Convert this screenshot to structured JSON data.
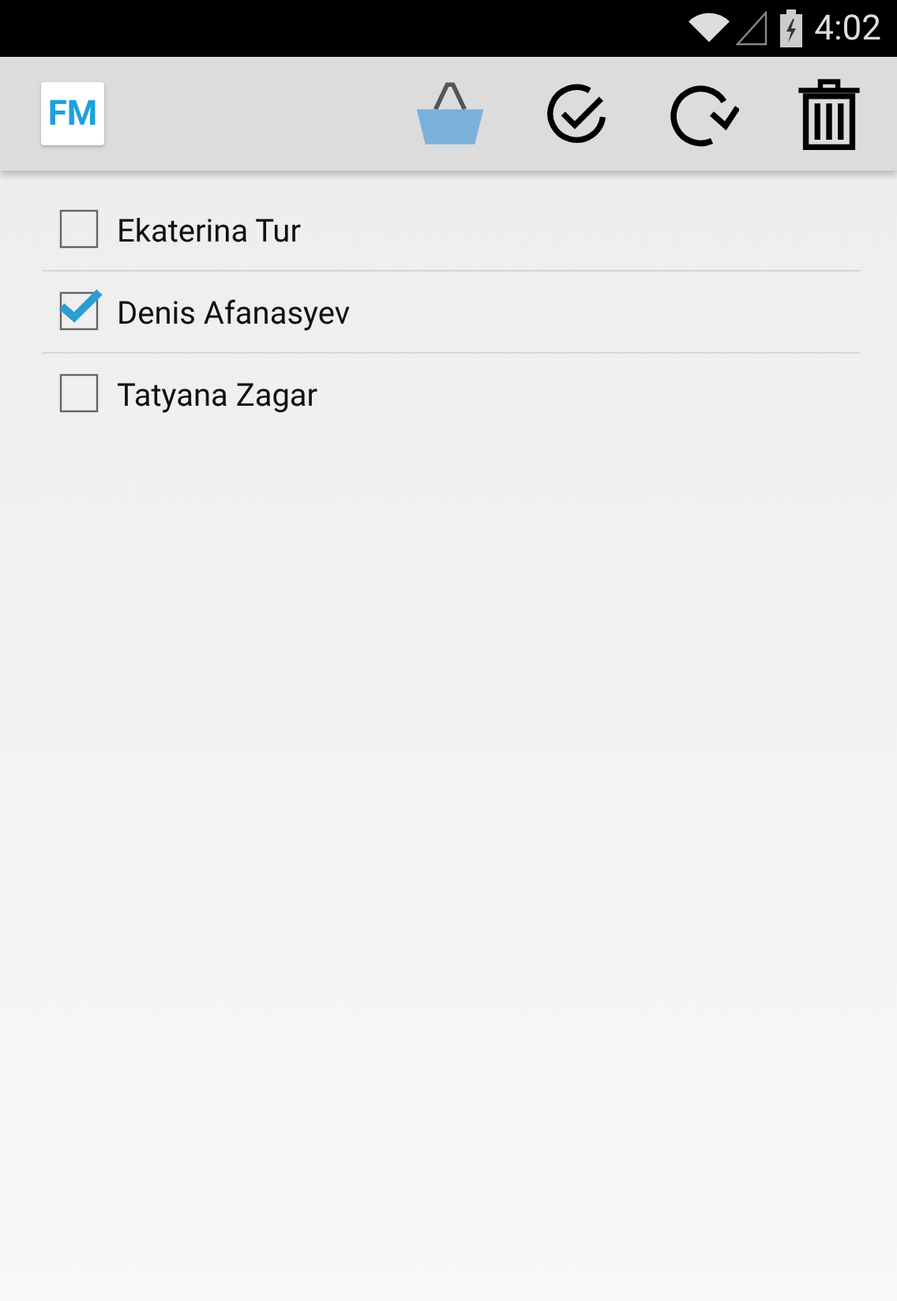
{
  "status_bar": {
    "time": "4:02"
  },
  "app_bar": {
    "logo": "FM"
  },
  "items": [
    {
      "name": "Ekaterina Tur",
      "checked": false
    },
    {
      "name": "Denis Afanasyev",
      "checked": true
    },
    {
      "name": "Tatyana Zagar",
      "checked": false
    }
  ]
}
